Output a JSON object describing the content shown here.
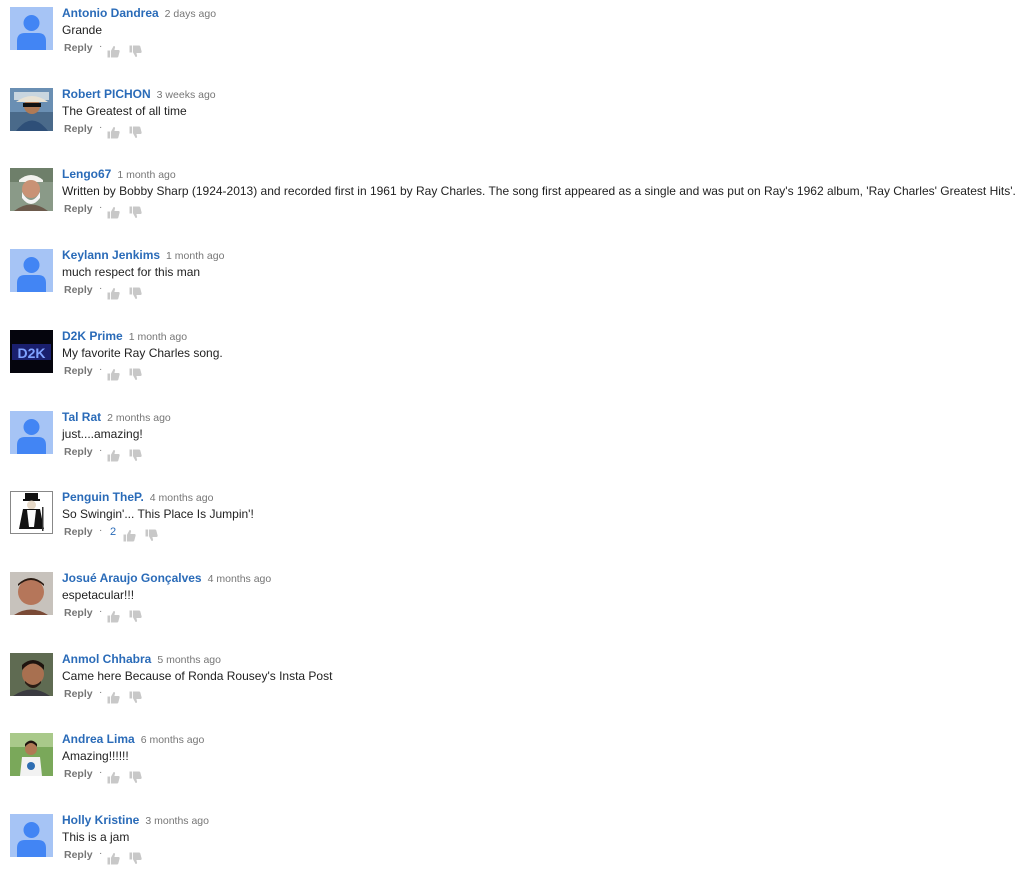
{
  "comments": [
    {
      "author": "Antonio Dandrea",
      "time": "2 days ago",
      "text": "Grande",
      "reply_label": "Reply",
      "likes": "",
      "avatar": "default-avatar-icon"
    },
    {
      "author": "Robert PICHON",
      "time": "3 weeks ago",
      "text": "The Greatest of all time",
      "reply_label": "Reply",
      "likes": "",
      "avatar": "user-photo-avatar"
    },
    {
      "author": "Lengo67",
      "time": "1 month ago",
      "text": "Written by Bobby Sharp (1924-2013) and recorded first in 1961 by Ray Charles. The song first appeared as a single and was put on Ray's 1962 album,  'Ray Charles' Greatest Hits'.",
      "reply_label": "Reply",
      "likes": "",
      "avatar": "user-photo-avatar"
    },
    {
      "author": "Keylann Jenkims",
      "time": "1 month ago",
      "text": "much respect for this man",
      "reply_label": "Reply",
      "likes": "",
      "avatar": "default-avatar-icon"
    },
    {
      "author": "D2K Prime",
      "time": "1 month ago",
      "text": "My favorite Ray Charles song.",
      "reply_label": "Reply",
      "likes": "",
      "avatar": "user-photo-avatar"
    },
    {
      "author": "Tal Rat",
      "time": "2 months ago",
      "text": "just....amazing!",
      "reply_label": "Reply",
      "likes": "",
      "avatar": "default-avatar-icon"
    },
    {
      "author": "Penguin TheP.",
      "time": "4 months ago",
      "text": "So Swingin'... This Place Is Jumpin'!",
      "reply_label": "Reply",
      "likes": "2",
      "avatar": "user-photo-avatar"
    },
    {
      "author": "Josué Araujo Gonçalves",
      "time": "4 months ago",
      "text": "espetacular!!!",
      "reply_label": "Reply",
      "likes": "",
      "avatar": "user-photo-avatar"
    },
    {
      "author": "Anmol Chhabra",
      "time": "5 months ago",
      "text": "Came here Because of Ronda Rousey's Insta Post",
      "reply_label": "Reply",
      "likes": "",
      "avatar": "user-photo-avatar"
    },
    {
      "author": "Andrea Lima",
      "time": "6 months ago",
      "text": "Amazing!!!!!!",
      "reply_label": "Reply",
      "likes": "",
      "avatar": "user-photo-avatar"
    },
    {
      "author": "Holly Kristine",
      "time": "3 months ago",
      "text": "This is a jam",
      "reply_label": "Reply",
      "likes": "",
      "avatar": "default-avatar-icon"
    }
  ],
  "colors": {
    "author_link": "#2a6bb8",
    "meta_gray": "#767676",
    "default_avatar_bg": "#a6c4f5",
    "default_avatar_figure": "#4285f4"
  }
}
